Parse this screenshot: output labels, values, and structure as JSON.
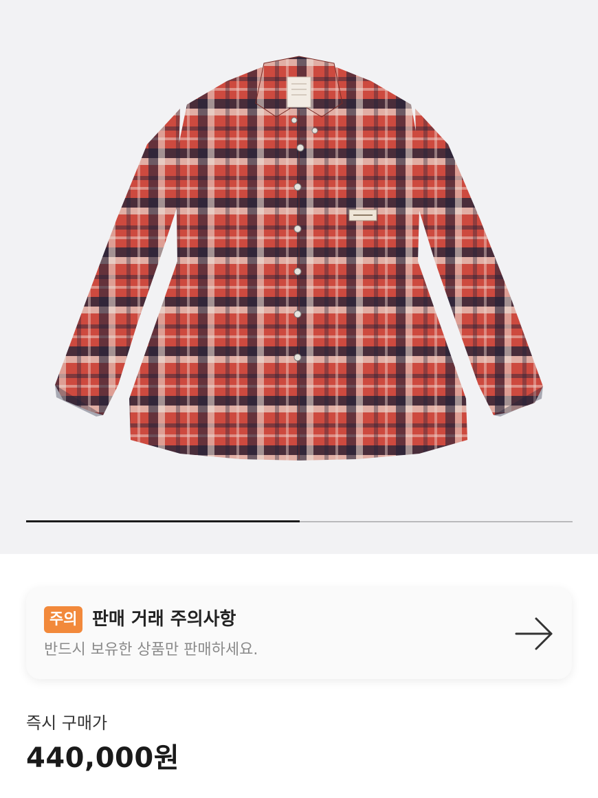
{
  "gallery": {
    "image_alt": "red plaid flannel shirt",
    "progress": 0.5
  },
  "notice": {
    "badge": "주의",
    "title": "판매 거래 주의사항",
    "subtitle": "반드시 보유한 상품만 판매하세요.",
    "action_icon": "arrow-right-icon"
  },
  "price": {
    "label": "즉시 구매가",
    "value": "440,000원"
  },
  "colors": {
    "badge": "#f2893b",
    "plaid_red": "#c9423a",
    "plaid_navy": "#1f2238",
    "plaid_cream": "#e8e0d6"
  }
}
